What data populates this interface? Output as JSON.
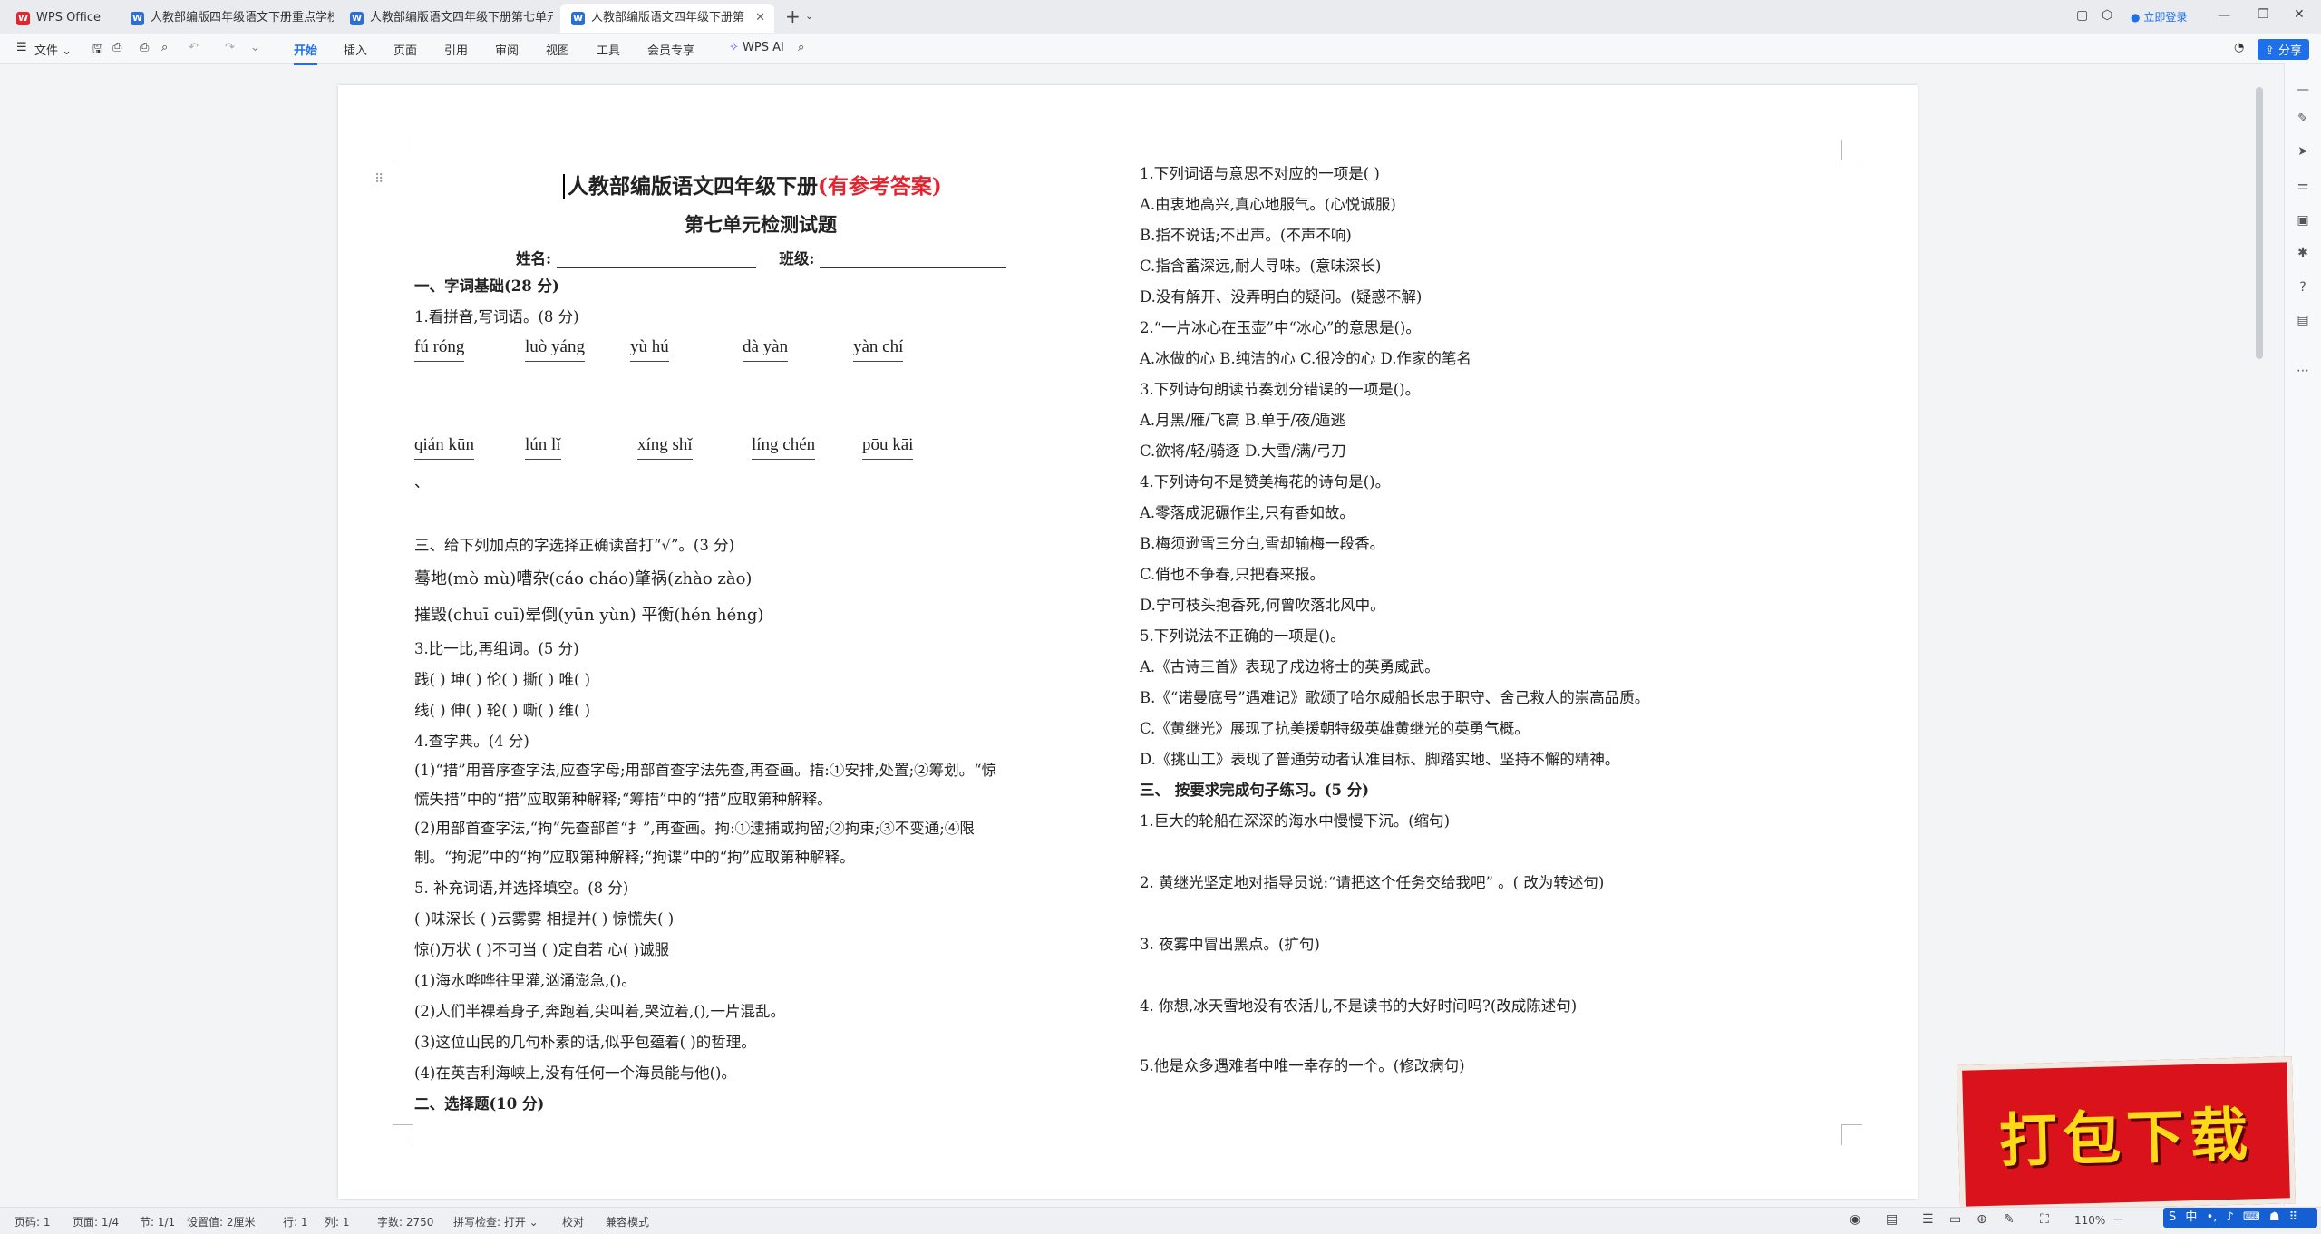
{
  "titlebar": {
    "tabs": [
      {
        "label": "WPS Office",
        "icon": "wps-logo-icon"
      },
      {
        "label": "人教部编版四年级语文下册重点学校",
        "icon": "word-doc-icon"
      },
      {
        "label": "人教部编版语文四年级下册第七单元",
        "icon": "word-doc-icon"
      },
      {
        "label": "人教部编版语文四年级下册第",
        "icon": "word-doc-icon",
        "active": true
      }
    ],
    "new_tab": "+",
    "login": "立即登录"
  },
  "toolbar": {
    "file": "文件",
    "menus": [
      "开始",
      "插入",
      "页面",
      "引用",
      "审阅",
      "视图",
      "工具",
      "会员专享"
    ],
    "active_menu": "开始",
    "wps_ai": "WPS AI",
    "share": "分享"
  },
  "doc": {
    "title": "人教部编版语文四年级下册",
    "title_red": "(有参考答案)",
    "subtitle": "第七单元检测试题",
    "name_label": "姓名:",
    "class_label": "班级:",
    "sec1": "一、字词基础(28 分)",
    "q1": "1.看拼音,写词语。(8 分)",
    "pinyin_row1": [
      "fú  róng",
      "luò yáng",
      "yù  hú",
      "dà yàn",
      "yàn chí"
    ],
    "pinyin_row2": [
      "qián kūn",
      "lún  lǐ",
      "xíng shǐ",
      "líng chén",
      "pōu kāi"
    ],
    "dot": "、",
    "q3_title": "三、给下列加点的字选择正确读音打“√”。(3 分)",
    "q3_line1": "蓦地(mò  mù)嘈杂(cáo  cháo)肇祸(zhào  zào)",
    "q3_line2": "摧毁(chuī  cuī)晕倒(yūn  yùn)     平衡(hén  héng)",
    "q4_title": "3.比一比,再组词。(5 分)",
    "q4_line1": "践(     )    坤(     )      伦(     )    撕(     )    唯(     )",
    "q4_line2": "线(     )    伸(     )      轮(     )    嘶(     )    维(     )",
    "q5_title": "4.查字典。(4 分)",
    "q5_p1a": "(1)“措”用音序查字法,应查字母;用部首查字法先查,再查画。措:①安排,处置;②筹划。“惊",
    "q5_p1b": "慌失措”中的“措”应取第种解释;“筹措”中的“措”应取第种解释。",
    "q5_p2a": "(2)用部首查字法,“拘”先查部首“扌”,再查画。拘:①逮捕或拘留;②拘束;③不变通;④限",
    "q5_p2b": "制。“拘泥”中的“拘”应取第种解释;“拘谍”中的“拘”应取第种解释。",
    "q6_title": "5.  补充词语,并选择填空。(8 分)",
    "q6_line1": "(   )味深长       (   )云雾雾        相提并(   )         惊慌失(   )",
    "q6_line2": "惊()万状       (   )不可当         (   )定自若          心(   )诚服",
    "q6_s1": "(1)海水哗哗往里灌,汹涌澎急,()。",
    "q6_s2": "(2)人们半裸着身子,奔跑着,尖叫着,哭泣着,(),一片混乱。",
    "q6_s3": "(3)这位山民的几句朴素的话,似乎包蕴着(          )的哲理。",
    "q6_s4": "(4)在英吉利海峡上,没有任何一个海员能与他()。",
    "sec2": "二、选择题(10 分)",
    "r1": "1.下列词语与意思不对应的一项是(   )",
    "r1a": "A.由衷地高兴,真心地服气。(心悦诚服)",
    "r1b": "B.指不说话;不出声。(不声不响)",
    "r1c": "C.指含蓄深远,耐人寻味。(意味深长)",
    "r1d": "D.没有解开、没弄明白的疑问。(疑惑不解)",
    "r2": "2.“一片冰心在玉壶”中“冰心”的意思是()。",
    "r2opts": "A.冰做的心     B.纯洁的心   C.很冷的心   D.作家的笔名",
    "r3": "3.下列诗句朗读节奏划分错误的一项是()。",
    "r3ab": "A.月黑/雁/飞高          B.单于/夜/遁逃",
    "r3cd": "C.欲将/轻/骑逐          D.大雪/满/弓刀",
    "r4": "4.下列诗句不是赞美梅花的诗句是()。",
    "r4a": "A.零落成泥碾作尘,只有香如故。",
    "r4b": "B.梅须逊雪三分白,雪却输梅一段香。",
    "r4c": "C.俏也不争春,只把春来报。",
    "r4d": "D.宁可枝头抱香死,何曾吹落北风中。",
    "r5": "5.下列说法不正确的一项是()。",
    "r5a": "A.《古诗三首》表现了戍边将士的英勇威武。",
    "r5b": "B.《“诺曼底号”遇难记》歌颂了哈尔威船长忠于职守、舍己救人的崇高品质。",
    "r5c": "C.《黄继光》展现了抗美援朝特级英雄黄继光的英勇气概。",
    "r5d": "D.《挑山工》表现了普通劳动者认准目标、脚踏实地、坚持不懈的精神。",
    "sec3": "三、  按要求完成句子练习。(5 分)",
    "s1": "1.巨大的轮船在深深的海水中慢慢下沉。(缩句)",
    "s2": "2. 黄继光坚定地对指导员说:“请把这个任务交给我吧”  。( 改为转述句)",
    "s3": "3. 夜雾中冒出黑点。(扩句)",
    "s4": "4. 你想,冰天雪地没有农活儿,不是读书的大好时间吗?(改成陈述句)",
    "s5": "5.他是众多遇难者中唯一幸存的一个。(修改病句)"
  },
  "status": {
    "page": "页码: 1",
    "pages": "页面: 1/4",
    "section": "节: 1/1",
    "setting": "设置值: 2厘米",
    "row": "行: 1",
    "col": "列: 1",
    "words": "字数: 2750",
    "spell": "拼写检查: 打开",
    "proof": "校对",
    "compat": "兼容模式",
    "zoom": "110%"
  },
  "banner": {
    "text": "打包下载"
  },
  "colors": {
    "accent": "#1f6feb",
    "title_red": "#e5232e",
    "banner_red": "#d9121b",
    "banner_text": "#ffd91a"
  }
}
